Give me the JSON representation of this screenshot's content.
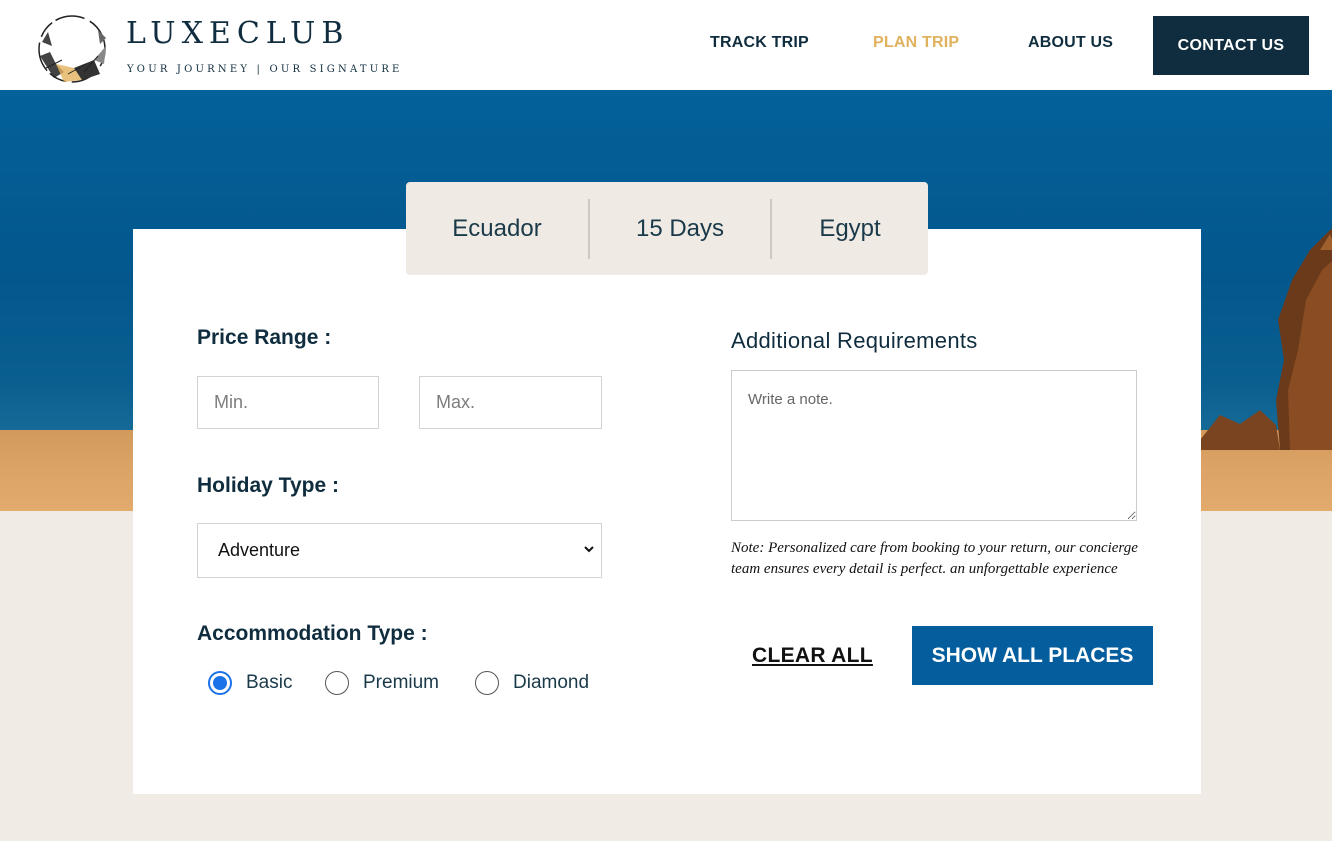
{
  "brand": {
    "name": "LUXECLUB",
    "tagline": "YOUR JOURNEY | OUR SIGNATURE"
  },
  "nav": {
    "track_trip": "TRACK TRIP",
    "plan_trip": "PLAN TRIP",
    "about_us": "ABOUT US",
    "contact_us": "CONTACT US",
    "active_item": "PLAN TRIP",
    "active_color": "#e1b25d"
  },
  "summary": {
    "origin": "Ecuador",
    "duration": "15 Days",
    "destination": "Egypt"
  },
  "form": {
    "price_range_label": "Price Range :",
    "min_placeholder": "Min.",
    "max_placeholder": "Max.",
    "holiday_type_label": "Holiday Type :",
    "holiday_type_value": "Adventure",
    "accommodation_label": "Accommodation Type :",
    "accommodation_options": [
      "Basic",
      "Premium",
      "Diamond"
    ],
    "accommodation_selected": "Basic",
    "requirements_label": "Additional Requirements",
    "note_placeholder": "Write a note.",
    "note_text": "Note: Personalized care from booking to your return, our concierge team ensures every detail is perfect. an unforgettable experience",
    "clear_label": "CLEAR ALL",
    "submit_label": "SHOW ALL PLACES"
  },
  "colors": {
    "primary_dark": "#0f2d3e",
    "accent_gold": "#e1b25d",
    "button_blue": "#045d9c",
    "background_beige": "#f1ebe6"
  }
}
